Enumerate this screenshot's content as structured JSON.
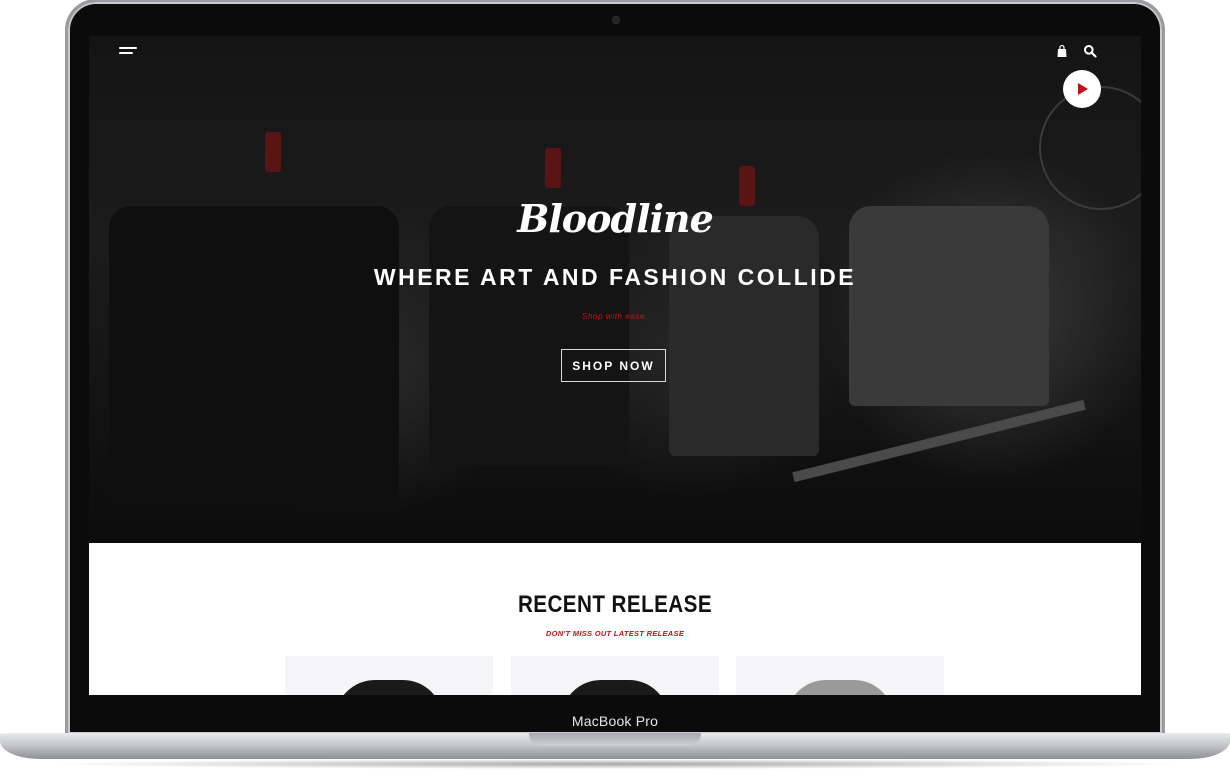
{
  "device": {
    "model_label": "MacBook Pro"
  },
  "site": {
    "brand": "Bloodline",
    "hero": {
      "headline": "WHERE ART AND FASHION COLLIDE",
      "tagline": "Shop with ease.",
      "cta_label": "SHOP NOW"
    },
    "nav": {
      "icons": [
        "menu-icon",
        "bag-icon",
        "search-icon",
        "play-icon"
      ]
    },
    "recent_release": {
      "title": "RECENT RELEASE",
      "subtitle": "DON'T MISS OUT LATEST RELEASE",
      "products": [
        {
          "color": "#1a1a1a"
        },
        {
          "color": "#1a1a1a"
        },
        {
          "color": "#9a9a9a"
        }
      ]
    },
    "colors": {
      "accent": "#c0121a",
      "hero_bg": "#141414",
      "card_bg": "#f5f5f7"
    }
  }
}
